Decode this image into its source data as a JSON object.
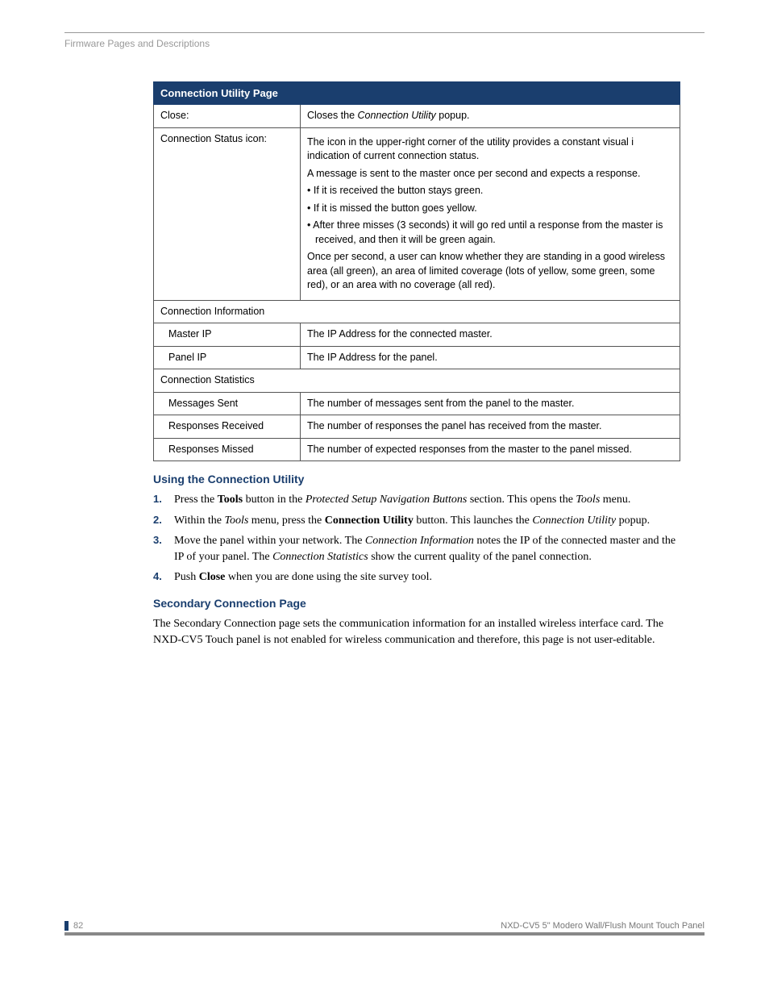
{
  "header": {
    "breadcrumb": "Firmware Pages and Descriptions"
  },
  "table": {
    "title": "Connection Utility Page",
    "rows": {
      "close": {
        "label": "Close:",
        "desc_pre": "Closes the ",
        "desc_ital": "Connection Utility",
        "desc_post": " popup."
      },
      "status": {
        "label": "Connection Status icon:",
        "p1": "The icon in the upper-right corner of the utility provides a constant visual i indication of current connection status.",
        "p2": "A message is sent to the master once per second and expects a response.",
        "b1": "If it is received the button stays green.",
        "b2": "If it is missed the button goes yellow.",
        "b3": "After three misses (3 seconds) it will go red until a response from the master is received, and then it will be green again.",
        "p3": "Once per second, a user can know whether they are standing in a good wireless area (all green), an area of limited coverage (lots of yellow, some green, some red), or an area with no coverage (all red)."
      },
      "conn_info": {
        "label": "Connection Information"
      },
      "master_ip": {
        "label": "Master IP",
        "desc": "The IP Address for the connected master."
      },
      "panel_ip": {
        "label": "Panel IP",
        "desc": "The IP Address for the panel."
      },
      "conn_stats": {
        "label": "Connection Statistics"
      },
      "msgs_sent": {
        "label": "Messages Sent",
        "desc": "The number of messages sent from the panel to the master."
      },
      "resp_recv": {
        "label": "Responses Received",
        "desc": "The number of responses the panel has received from the master."
      },
      "resp_miss": {
        "label": "Responses Missed",
        "desc": "The number of expected responses from the master to the panel missed."
      }
    }
  },
  "using": {
    "heading": "Using the Connection Utility",
    "steps": {
      "s1": {
        "num": "1.",
        "a": "Press the ",
        "b": "Tools",
        "c": " button in the ",
        "d": "Protected Setup Navigation Buttons",
        "e": " section. This opens the ",
        "f": "Tools",
        "g": " menu."
      },
      "s2": {
        "num": "2.",
        "a": "Within the ",
        "b": "Tools",
        "c": " menu, press the ",
        "d": "Connection Utility",
        "e": " button. This launches the ",
        "f": "Connection Utility",
        "g": " popup."
      },
      "s3": {
        "num": "3.",
        "a": "Move the panel within your network. The ",
        "b": "Connection Information",
        "c": " notes the IP of the connected master and the IP of your panel. The ",
        "d": "Connection Statistics",
        "e": " show the current quality of the panel connection."
      },
      "s4": {
        "num": "4.",
        "a": "Push ",
        "b": "Close",
        "c": " when you are done using the site survey tool."
      }
    }
  },
  "secondary": {
    "heading": "Secondary Connection Page",
    "body": "The Secondary Connection page sets the communication information for an installed wireless interface card. The NXD-CV5 Touch panel is not enabled for wireless communication and therefore, this page is not user-editable."
  },
  "footer": {
    "page": "82",
    "title": "NXD-CV5 5\" Modero Wall/Flush Mount Touch Panel"
  }
}
